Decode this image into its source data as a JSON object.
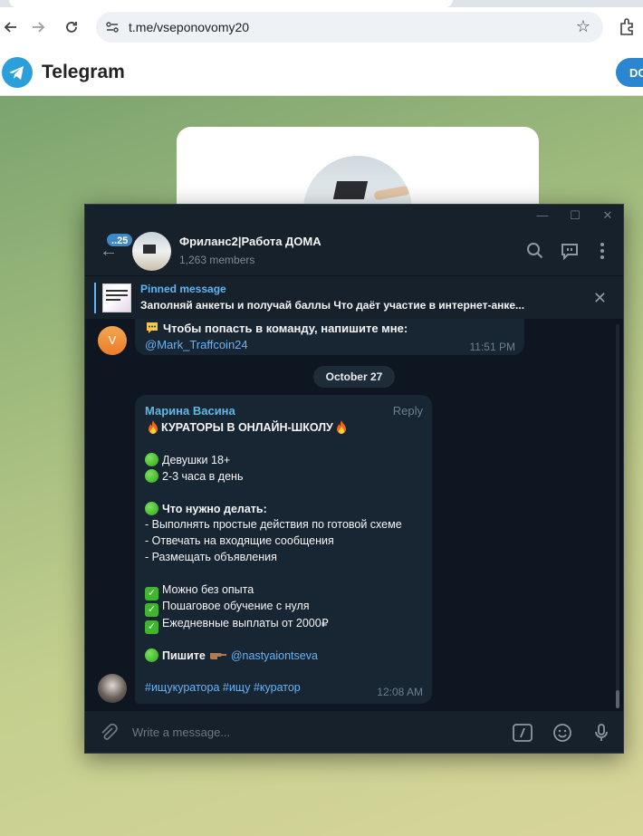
{
  "browser": {
    "url": "t.me/vseponovomy20",
    "back_icon": "arrow-left-icon",
    "forward_icon": "arrow-right-icon",
    "reload_icon": "reload-icon"
  },
  "telegram_web": {
    "title": "Telegram",
    "download_label": "DO"
  },
  "window": {
    "minimize": "—",
    "maximize": "☐",
    "close": "✕"
  },
  "chat": {
    "unread_count": "..25",
    "title": "Фриланс2|Работа ДОМА",
    "members": "1,263 members"
  },
  "pinned": {
    "label": "Pinned message",
    "text": "Заполняй анкеты и получай баллы  Что даёт участие в интернет-анке..."
  },
  "messages": {
    "prev": {
      "avatar_letter": "V",
      "line": "Чтобы попасть в команду, напишите мне:",
      "link": "@Mark_Traffcoin24",
      "time": "11:51 PM"
    },
    "date_separator": "October 27",
    "post": {
      "author": "Марина Васина",
      "reply": "Reply",
      "headline": "КУРАТОРЫ В ОНЛАЙН-ШКОЛУ",
      "req1": "Девушки 18+",
      "req2": "2-3 часа в день",
      "todo_heading": "Что нужно делать:",
      "todo1": "- Выполнять простые действия по готовой схеме",
      "todo2": "- Отвечать на входящие сообщения",
      "todo3": "- Размещать объявления",
      "ok1": "Можно без опыта",
      "ok2": "Пошаговое обучение с нуля",
      "ok3": "Ежедневные выплаты от 2000₽",
      "write_label": "Пишите",
      "mention": "@nastyaiontseva",
      "tags": "#ищукуратора #ищу #куратор",
      "time": "12:08 AM"
    }
  },
  "composer": {
    "placeholder": "Write a message..."
  },
  "colors": {
    "accent": "#5eb5f7",
    "bg_dark": "#0e1621",
    "panel": "#17212b",
    "bubble": "#182533"
  }
}
